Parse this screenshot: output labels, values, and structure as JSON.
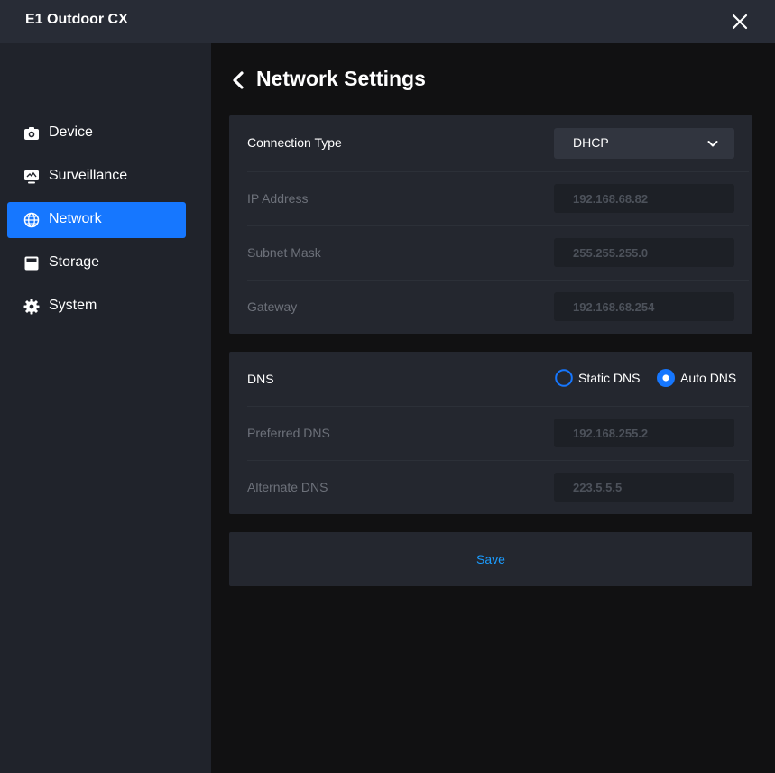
{
  "window": {
    "title": "E1 Outdoor CX",
    "close_icon": "close-icon"
  },
  "sidebar": {
    "items": [
      {
        "label": "Device",
        "icon": "camera-icon",
        "active": false
      },
      {
        "label": "Surveillance",
        "icon": "monitor-icon",
        "active": false
      },
      {
        "label": "Network",
        "icon": "globe-icon",
        "active": true
      },
      {
        "label": "Storage",
        "icon": "storage-icon",
        "active": false
      },
      {
        "label": "System",
        "icon": "gear-icon",
        "active": false
      }
    ]
  },
  "page": {
    "title": "Network Settings",
    "back_icon": "chevron-left-icon"
  },
  "ip_settings": {
    "connection_type_label": "Connection Type",
    "connection_type_value": "DHCP",
    "ip_address_label": "IP Address",
    "ip_address_value": "192.168.68.82",
    "subnet_mask_label": "Subnet Mask",
    "subnet_mask_value": "255.255.255.0",
    "gateway_label": "Gateway",
    "gateway_value": "192.168.68.254"
  },
  "dns_settings": {
    "dns_label": "DNS",
    "static_dns_label": "Static DNS",
    "auto_dns_label": "Auto DNS",
    "selected": "Auto DNS",
    "preferred_dns_label": "Preferred DNS",
    "preferred_dns_value": "192.168.255.2",
    "alternate_dns_label": "Alternate DNS",
    "alternate_dns_value": "223.5.5.5"
  },
  "actions": {
    "save_label": "Save"
  },
  "colors": {
    "accent": "#1677ff",
    "link": "#1b9cff",
    "titlebar": "#282c36",
    "sidebar": "#20232b",
    "card": "#24272f"
  }
}
